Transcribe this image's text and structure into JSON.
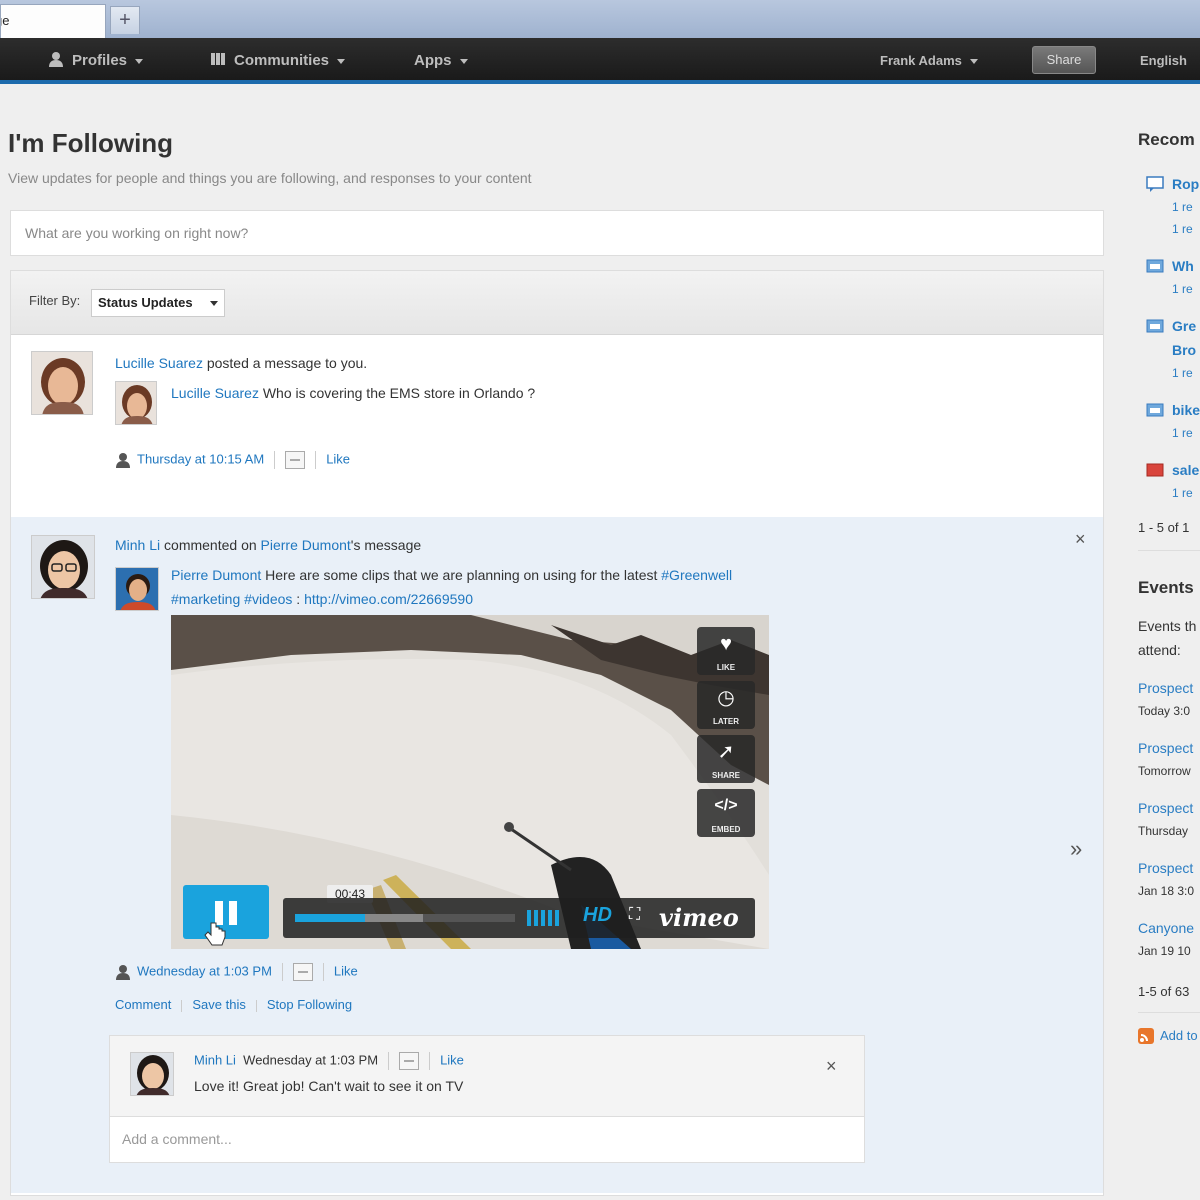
{
  "browser": {
    "tab_label": "ge",
    "new_tab_label": "+"
  },
  "nav": {
    "profiles": "Profiles",
    "communities": "Communities",
    "apps": "Apps",
    "user": "Frank Adams",
    "share": "Share",
    "language": "English"
  },
  "page": {
    "title": "I'm Following",
    "subtitle": "View updates for people and things you are following, and responses to your content",
    "status_placeholder": "What are you working on right now?",
    "filter_label": "Filter By:",
    "filter_value": "Status Updates"
  },
  "entry1": {
    "actor": "Lucille Suarez",
    "action": " posted a message to you.",
    "msg_author": "Lucille Suarez",
    "msg_text": " Who is covering the EMS store in Orlando ?",
    "time": "Thursday at 10:15 AM",
    "like": "Like"
  },
  "entry2": {
    "actor": "Minh Li",
    "action1": " commented on ",
    "target": "Pierre Dumont",
    "action2": "'s message",
    "msg_author": "Pierre Dumont",
    "msg_text": " Here are some clips that we are planning on using for the latest ",
    "tag1": "#Greenwell",
    "tag2": "#marketing",
    "tag3": "#videos",
    "colon": " : ",
    "url": "http://vimeo.com/22669590",
    "time": "Wednesday at 1:03 PM",
    "like": "Like",
    "comment": "Comment",
    "save": "Save this",
    "stop": "Stop Following",
    "close": "×"
  },
  "video": {
    "like": "LIKE",
    "later": "LATER",
    "share": "SHARE",
    "embed": "EMBED",
    "time": "00:43",
    "hd": "HD",
    "brand": "vimeo",
    "played_fraction": 0.32,
    "loaded_fraction": 0.58
  },
  "reply": {
    "author": "Minh Li",
    "time": "Wednesday at 1:03 PM",
    "like": "Like",
    "text": "Love it! Great job! Can't wait to see it on TV",
    "add_placeholder": "Add a comment...",
    "close": "×"
  },
  "right": {
    "recommend_title": "Recom",
    "items": [
      {
        "title": "Rop",
        "sub1": "1 re",
        "sub2": "1 re"
      },
      {
        "title": "Wh",
        "sub1": "1 re"
      },
      {
        "title": "Gre",
        "title2": "Bro",
        "sub1": "1 re"
      },
      {
        "title": "bike",
        "sub1": "1 re"
      },
      {
        "title": "sale",
        "sub1": "1 re"
      }
    ],
    "pager": "1 - 5 of 1",
    "events_title": "Events",
    "events_desc1": "Events th",
    "events_desc2": "attend:",
    "events": [
      {
        "title": "Prospect",
        "date": "Today 3:0"
      },
      {
        "title": "Prospect",
        "date": "Tomorrow"
      },
      {
        "title": "Prospect",
        "date": "Thursday"
      },
      {
        "title": "Prospect",
        "date": "Jan 18 3:0"
      },
      {
        "title": "Canyone",
        "date": "Jan 19 10"
      }
    ],
    "events_pager": "1-5 of 63",
    "add": "Add to"
  },
  "scroll_arrow": "»"
}
